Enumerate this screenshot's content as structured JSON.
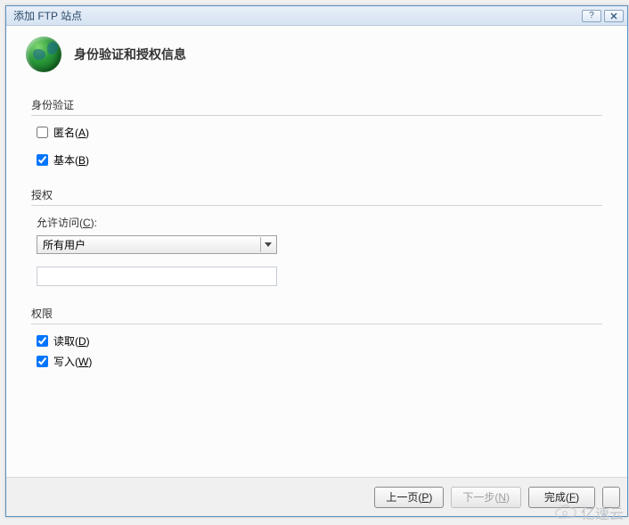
{
  "titlebar": {
    "title": "添加 FTP 站点"
  },
  "header": {
    "page_title": "身份验证和授权信息"
  },
  "auth_group": {
    "label": "身份验证",
    "anonymous": {
      "label": "匿名(",
      "accel": "A",
      "suffix": ")",
      "checked": false
    },
    "basic": {
      "label": "基本(",
      "accel": "B",
      "suffix": ")",
      "checked": true
    }
  },
  "authz_group": {
    "label": "授权",
    "allow_access": {
      "label": "允许访问(",
      "accel": "C",
      "suffix": "):"
    },
    "dropdown_value": "所有用户",
    "textbox_value": ""
  },
  "perm_group": {
    "label": "权限",
    "read": {
      "label": "读取(",
      "accel": "D",
      "suffix": ")",
      "checked": true
    },
    "write": {
      "label": "写入(",
      "accel": "W",
      "suffix": ")",
      "checked": true
    }
  },
  "buttons": {
    "prev": "上一页(P)",
    "next": "下一步(N)",
    "finish": "完成(F)"
  },
  "watermark": "亿速云"
}
